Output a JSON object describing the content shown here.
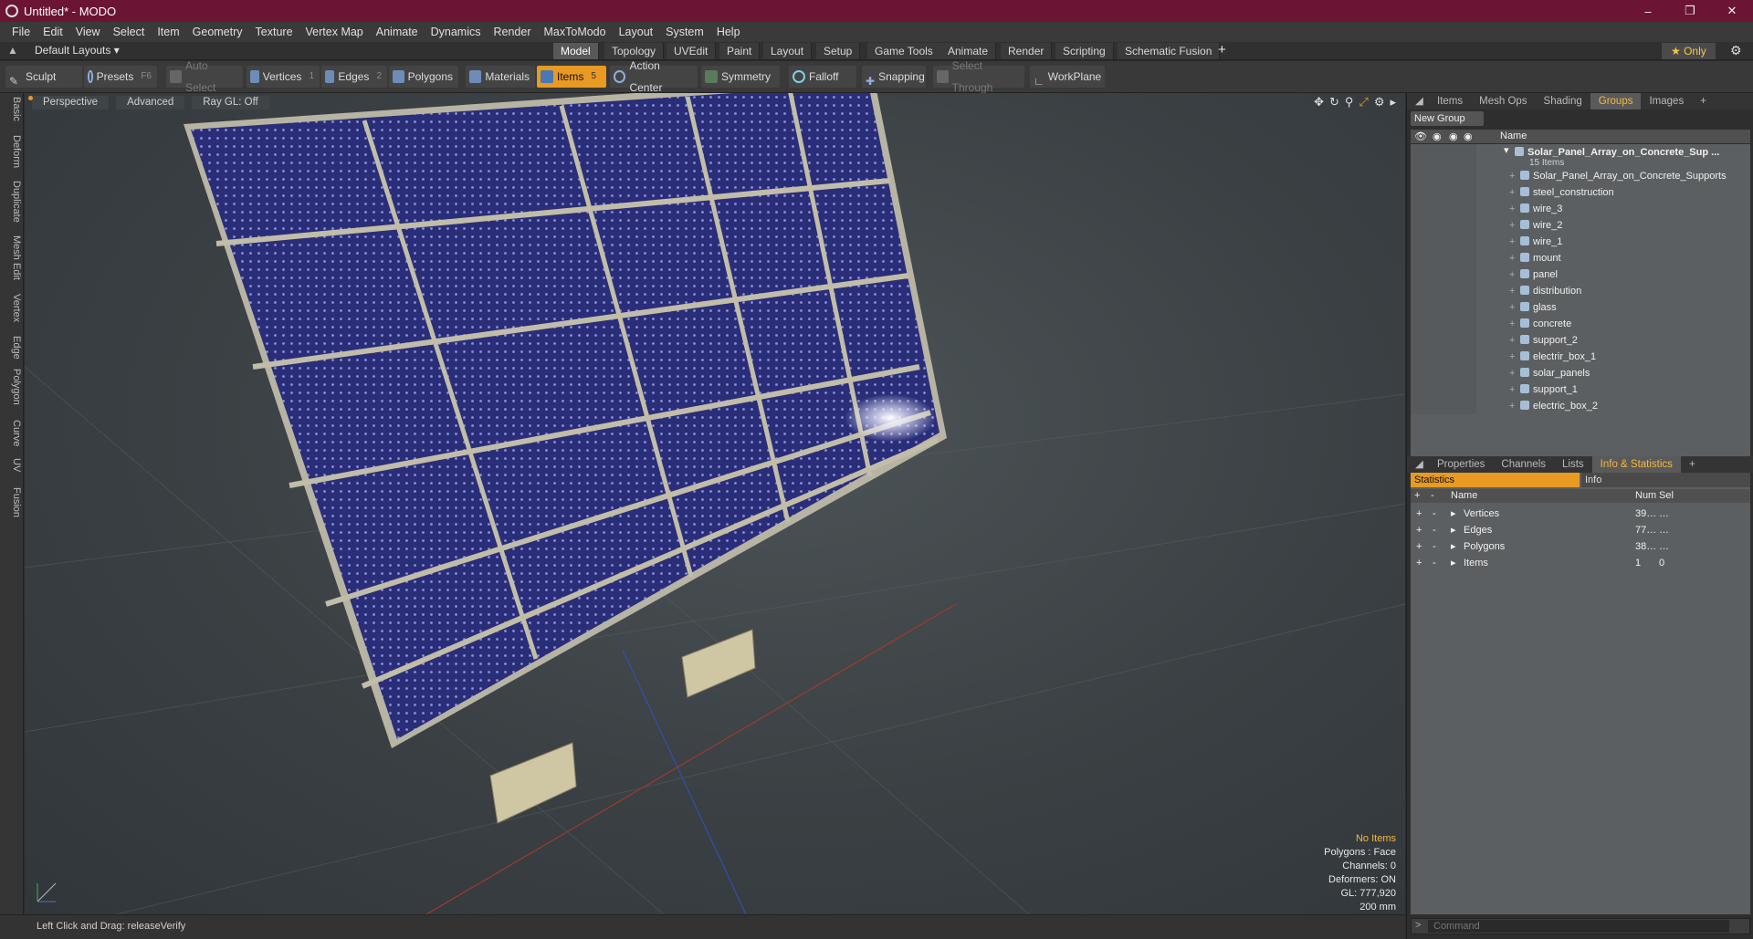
{
  "window": {
    "title": "Untitled* - MODO"
  },
  "menu": [
    "File",
    "Edit",
    "View",
    "Select",
    "Item",
    "Geometry",
    "Texture",
    "Vertex Map",
    "Animate",
    "Dynamics",
    "Render",
    "MaxToModo",
    "Layout",
    "System",
    "Help"
  ],
  "layout_bar": {
    "preset": "Default Layouts ▾",
    "tabs": [
      "Model",
      "Topology",
      "UVEdit",
      "Paint",
      "Layout",
      "Setup",
      "Game Tools",
      "Animate",
      "Render",
      "Scripting",
      "Schematic Fusion"
    ],
    "active_tab": "Model",
    "add": "+",
    "only": "★ Only"
  },
  "toolbar": {
    "sculpt": "Sculpt",
    "presets": "Presets",
    "presets_key": "F6",
    "auto_select": "Auto Select",
    "vertices": "Vertices",
    "vertices_count": "1",
    "edges": "Edges",
    "edges_count": "2",
    "polygons": "Polygons",
    "materials": "Materials",
    "items": "Items",
    "items_count": "5",
    "action_center": "Action Center",
    "symmetry": "Symmetry",
    "falloff": "Falloff",
    "snapping": "Snapping",
    "select_through": "Select Through",
    "workplane": "WorkPlane"
  },
  "left_tabs": [
    "Basic",
    "Deform",
    "Duplicate",
    "Mesh Edit",
    "Vertex",
    "Edge",
    "Polygon",
    "Curve",
    "UV",
    "Fusion"
  ],
  "viewport": {
    "view": "Perspective",
    "mode": "Advanced",
    "raygl": "Ray GL: Off",
    "info": {
      "selection": "No Items",
      "polygons": "Polygons : Face",
      "channels": "Channels: 0",
      "deformers": "Deformers: ON",
      "gl": "GL: 777,920",
      "scale": "200 mm"
    }
  },
  "status": {
    "text": "Left Click and Drag:  releaseVerify"
  },
  "groups_panel": {
    "tabs": [
      "Items",
      "Mesh Ops",
      "Shading",
      "Groups",
      "Images"
    ],
    "active_tab": "Groups",
    "new_group": "New Group",
    "name_header": "Name",
    "root": {
      "name": "Solar_Panel_Array_on_Concrete_Sup ...",
      "sub": "15 Items"
    },
    "items": [
      "Solar_Panel_Array_on_Concrete_Supports",
      "steel_construction",
      "wire_3",
      "wire_2",
      "wire_1",
      "mount",
      "panel",
      "distribution",
      "glass",
      "concrete",
      "support_2",
      "electrir_box_1",
      "solar_panels",
      "support_1",
      "electric_box_2"
    ]
  },
  "stats_panel": {
    "tabs": [
      "Properties",
      "Channels",
      "Lists",
      "Info & Statistics"
    ],
    "active_tab": "Info & Statistics",
    "subtabs": {
      "statistics": "Statistics",
      "info": "Info"
    },
    "headers": {
      "name": "Name",
      "num": "Num",
      "sel": "Sel"
    },
    "rows": [
      {
        "name": "Vertices",
        "num": "39…",
        "sel": "…"
      },
      {
        "name": "Edges",
        "num": "77…",
        "sel": "…"
      },
      {
        "name": "Polygons",
        "num": "38…",
        "sel": "…"
      },
      {
        "name": "Items",
        "num": "1",
        "sel": "0"
      }
    ]
  },
  "command": {
    "placeholder": "Command"
  },
  "colors": {
    "titlebar": "#6b1434",
    "accent": "#e89a22",
    "panel_cells": "#2a2e7a",
    "frame": "#b8b4a4"
  }
}
